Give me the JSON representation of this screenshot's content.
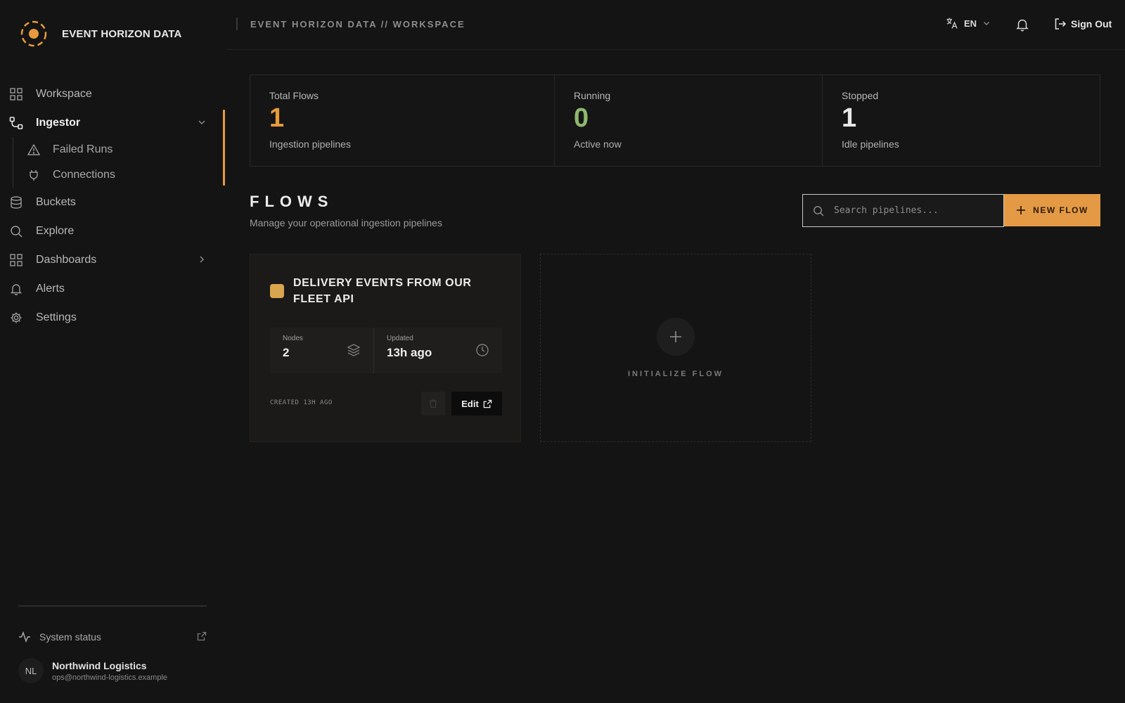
{
  "brand": {
    "name": "EVENT HORIZON DATA"
  },
  "sidebar": {
    "items": [
      {
        "label": "Workspace",
        "icon": "grid-icon"
      },
      {
        "label": "Ingestor",
        "icon": "flow-icon",
        "active": true
      },
      {
        "label": "Buckets",
        "icon": "database-icon"
      },
      {
        "label": "Explore",
        "icon": "search-icon"
      },
      {
        "label": "Dashboards",
        "icon": "grid-icon"
      },
      {
        "label": "Alerts",
        "icon": "bell-icon"
      },
      {
        "label": "Settings",
        "icon": "gear-icon"
      }
    ],
    "sub_items": [
      {
        "label": "Failed Runs",
        "icon": "warning-icon"
      },
      {
        "label": "Connections",
        "icon": "plug-icon"
      }
    ],
    "system_status": "System status",
    "user": {
      "initials": "NL",
      "name": "Northwind Logistics",
      "email": "ops@northwind-logistics.example"
    }
  },
  "topbar": {
    "breadcrumb": "EVENT HORIZON DATA // WORKSPACE",
    "language": "EN",
    "sign_out": "Sign Out"
  },
  "stats": [
    {
      "title": "Total Flows",
      "value": "1",
      "sub": "Ingestion pipelines",
      "color": "#e89a3c"
    },
    {
      "title": "Running",
      "value": "0",
      "sub": "Active now",
      "color": "#8fb86f"
    },
    {
      "title": "Stopped",
      "value": "1",
      "sub": "Idle pipelines",
      "color": "#e8e8e8"
    }
  ],
  "flows": {
    "title": "FLOWS",
    "subtitle": "Manage your operational ingestion pipelines",
    "search_placeholder": "Search pipelines...",
    "new_flow": "NEW FLOW",
    "cards": [
      {
        "name": "DELIVERY EVENTS FROM OUR FLEET API",
        "nodes_label": "Nodes",
        "nodes_value": "2",
        "updated_label": "Updated",
        "updated_value": "13h ago",
        "created": "CREATED 13H AGO",
        "edit": "Edit"
      }
    ],
    "initialize": "INITIALIZE FLOW"
  },
  "colors": {
    "accent": "#e89a3c",
    "running": "#8fb86f",
    "background": "#141414"
  }
}
